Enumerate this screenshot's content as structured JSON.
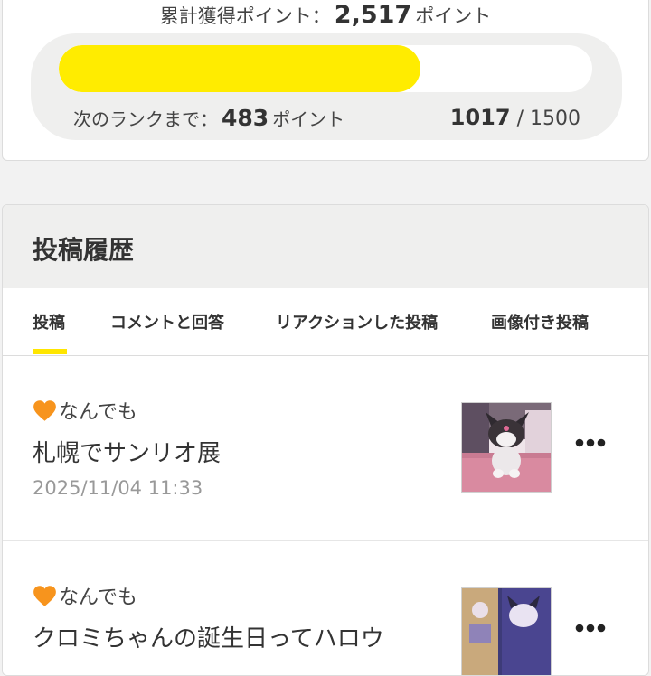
{
  "points": {
    "total_label": "累計獲得ポイント：",
    "total_value": "2,517",
    "total_unit": "ポイント",
    "next_rank_label": "次のランクまで：",
    "next_rank_value": "483",
    "next_rank_unit": "ポイント",
    "current": "1017",
    "separator": "/",
    "target": "1500",
    "progress_fraction": 0.678,
    "bar_color": "#FFEC00"
  },
  "history": {
    "title": "投稿履歴",
    "tabs": [
      {
        "label": "投稿",
        "active": true
      },
      {
        "label": "コメントと回答",
        "active": false
      },
      {
        "label": "リアクションした投稿",
        "active": false
      },
      {
        "label": "画像付き投稿",
        "active": false
      }
    ],
    "accent_color": "#FFE600",
    "posts": [
      {
        "category": "なんでも",
        "title": "札幌でサンリオ展",
        "date": "2025/11/04 11:33",
        "icon": "heart-icon"
      },
      {
        "category": "なんでも",
        "title": "クロミちゃんの誕生日ってハロウ",
        "date": "",
        "icon": "heart-icon"
      }
    ],
    "heart_color": "#F7941D"
  }
}
